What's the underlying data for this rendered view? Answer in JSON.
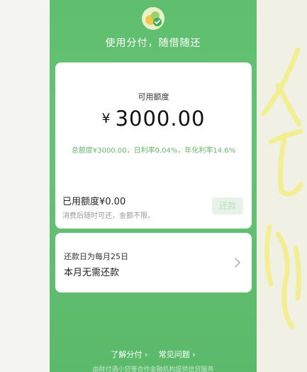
{
  "header": {
    "logo_icon": "dual-circle-check-logo",
    "slogan": "使用分付，随借随还"
  },
  "credit": {
    "available_label": "可用额度",
    "currency_symbol": "¥",
    "available_amount": "3000.00",
    "limit_detail": "总额度¥3000.00，日利率0.04%，年化利率14.6%",
    "used_label": "已用额度¥0.00",
    "used_note": "消费后随时可还，金额不限。",
    "repay_button": "还款"
  },
  "repayment": {
    "due_date": "还款日为每月25日",
    "status": "本月无需还款",
    "chevron_icon": "chevron-right-icon"
  },
  "footer": {
    "link_learn": "了解分付",
    "link_faq": "常见问题",
    "note": "由财付通小贷等合作金融机构提供信贷服务"
  },
  "colors": {
    "brand_green": "#5fbf6e",
    "detail_green": "#6ab66f",
    "handwriting": "#f3ef86"
  }
}
